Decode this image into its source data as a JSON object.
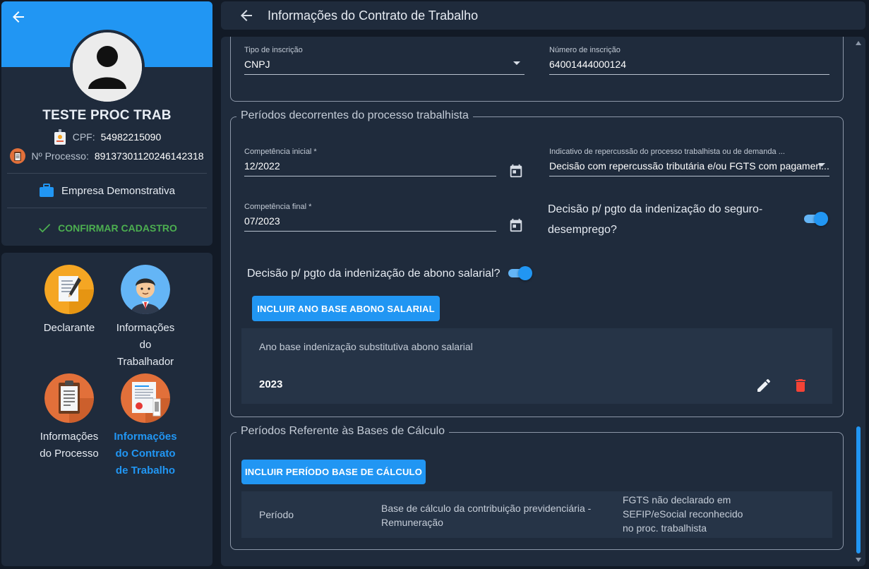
{
  "profile": {
    "name": "TESTE PROC TRAB",
    "cpf_label": "CPF:",
    "cpf_value": "54982215090",
    "process_label": "Nº Processo:",
    "process_value": "89137301120246142318",
    "company": "Empresa Demonstrativa",
    "confirm_label": "CONFIRMAR CADASTRO"
  },
  "nav": {
    "items": [
      {
        "label": "Declarante",
        "icon": "document-pen-icon"
      },
      {
        "label": "Informações do Trabalhador",
        "icon": "worker-avatar-icon"
      },
      {
        "label": "Informações do Processo",
        "icon": "clipboard-icon"
      },
      {
        "label": "Informações do Contrato de Trabalho",
        "icon": "contract-icon"
      }
    ],
    "active_index": 3
  },
  "header": {
    "title": "Informações do Contrato de Trabalho"
  },
  "inscricao": {
    "tipo_label": "Tipo de inscrição",
    "tipo_value": "CNPJ",
    "numero_label": "Número de inscrição",
    "numero_value": "64001444000124"
  },
  "periodos_processo": {
    "legend": "Períodos decorrentes do processo trabalhista",
    "competencia_inicial_label": "Competência inicial *",
    "competencia_inicial_value": "12/2022",
    "indicativo_label": "Indicativo de repercussão do processo trabalhista ou de demanda ...",
    "indicativo_value": "Decisão com repercussão tributária e/ou FGTS com pagamen...",
    "competencia_final_label": "Competência final *",
    "competencia_final_value": "07/2023",
    "seguro_desemprego_question": "Decisão p/ pgto da indenização do seguro-desemprego?",
    "seguro_desemprego_on": true,
    "abono_question": "Decisão p/ pgto da indenização de abono salarial?",
    "abono_on": true,
    "incluir_abono_button": "INCLUIR ANO BASE ABONO SALARIAL",
    "abono_table_header": "Ano base indenização substitutiva abono salarial",
    "abono_rows": [
      "2023"
    ]
  },
  "bases_calculo": {
    "legend": "Períodos Referente às Bases de Cálculo",
    "incluir_button": "INCLUIR PERÍODO BASE DE CÁLCULO",
    "col_periodo": "Período",
    "col_base": "Base de cálculo da contribuição previdenciária - Remuneração",
    "col_fgts": "FGTS não declarado em SEFIP/eSocial reconhecido no proc. trabalhista"
  },
  "colors": {
    "primary": "#2196f3",
    "success": "#4caf50",
    "danger": "#f44336",
    "background": "#121a26",
    "card": "#1f2b3c"
  }
}
